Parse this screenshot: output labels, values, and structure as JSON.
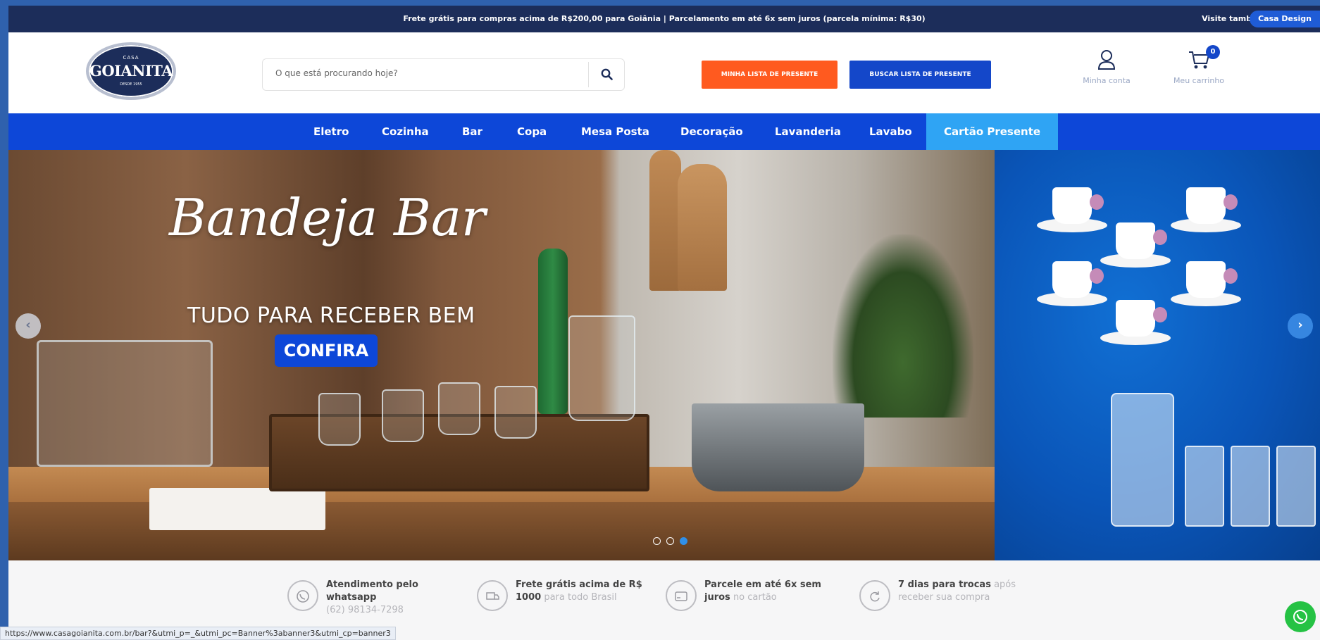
{
  "topbar": {
    "message": "Frete grátis para compras acima de R$200,00 para Goiânia | Parcelamento em até 6x sem juros (parcela mínima: R$30)",
    "visit_label": "Visite também",
    "casa_design": "Casa Design"
  },
  "logo": {
    "top": "CASA",
    "name": "GOIANITA",
    "since": "DESDE 1955"
  },
  "search": {
    "placeholder": "O que está procurando hoje?"
  },
  "header": {
    "gift_list_button": "MINHA LISTA DE PRESENTE",
    "find_gift_list_button": "BUSCAR LISTA DE PRESENTE",
    "account_label": "Minha conta",
    "cart_label": "Meu carrinho",
    "cart_count": "0"
  },
  "nav": {
    "items": [
      "Eletro",
      "Cozinha",
      "Bar",
      "Copa",
      "Mesa Posta",
      "Decoração",
      "Lavanderia",
      "Lavabo",
      "Cartão Presente"
    ]
  },
  "hero": {
    "headline": "Bandeja Bar",
    "subhead": "TUDO PARA RECEBER BEM",
    "cta": "CONFIRA",
    "slide_count": 3,
    "active_slide": 3
  },
  "benefits": [
    {
      "icon": "whatsapp-icon",
      "bold": "Atendimento pelo whatsapp",
      "light": "(62) 98134-7298"
    },
    {
      "icon": "truck-icon",
      "bold": "Frete grátis acima de R$ 1000",
      "light": "para todo Brasil"
    },
    {
      "icon": "card-icon",
      "bold": "Parcele em até 6x sem juros",
      "light": "no cartão"
    },
    {
      "icon": "return-icon",
      "bold": "7 dias para trocas",
      "light": "após receber sua compra"
    }
  ],
  "status_url": "https://www.casagoianita.com.br/bar?&utmi_p=_&utmi_pc=Banner%3abanner3&utmi_cp=banner3",
  "colors": {
    "topbar": "#1c2d5a",
    "nav": "#0d47d8",
    "nav_active": "#2fa4f4",
    "gift_button": "#ff5a1f",
    "find_button": "#1447c9",
    "whatsapp": "#25c244"
  }
}
